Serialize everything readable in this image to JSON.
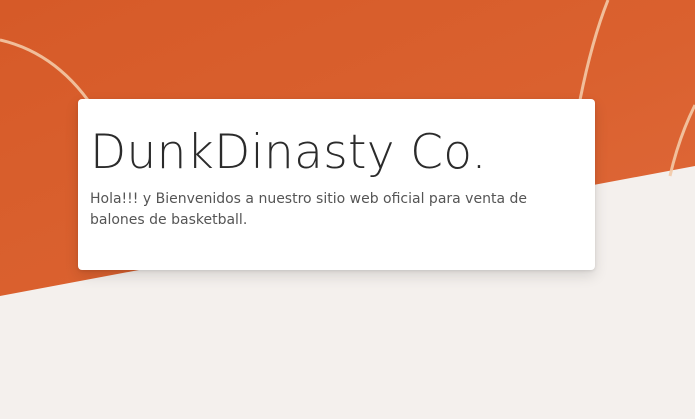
{
  "hero": {
    "title": "DunkDinasty Co.",
    "subtitle": "Hola!!! y Bienvenidos a nuestro sitio web oficial para venta de balones de basketball."
  },
  "colors": {
    "ball_orange": "#d95f2c",
    "ball_lines": "#f3c9a6",
    "page_background": "#f4f0ed",
    "card_background": "#ffffff"
  }
}
